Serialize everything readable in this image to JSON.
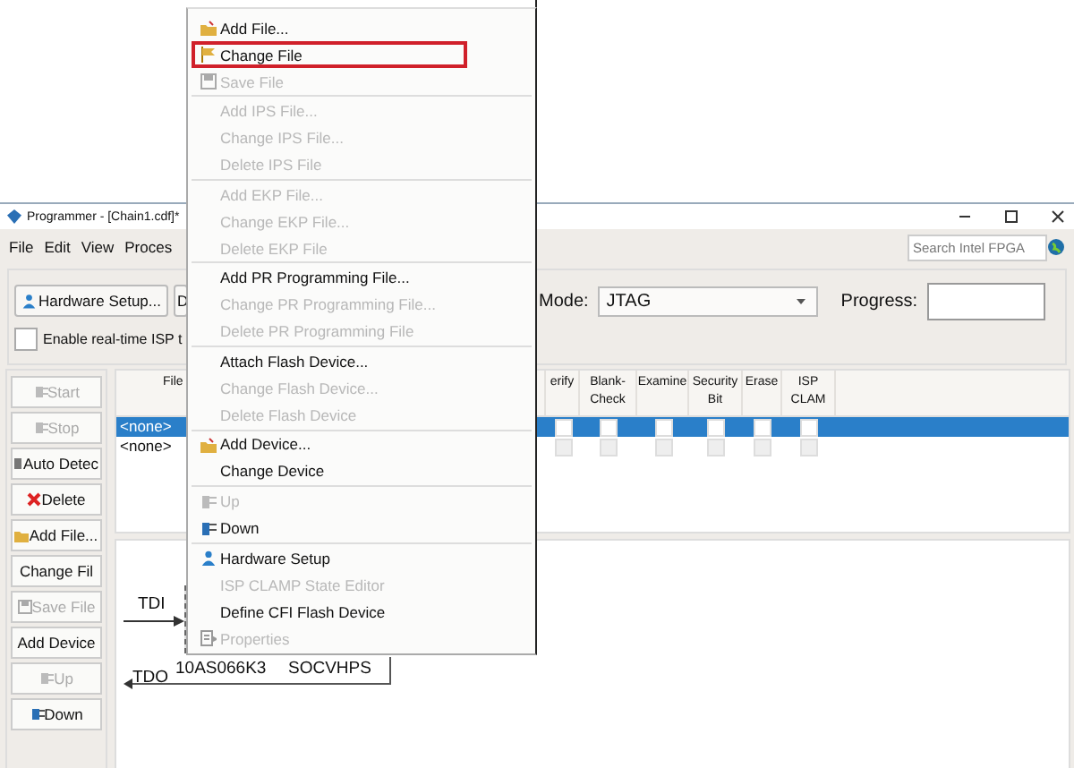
{
  "window": {
    "title": "Programmer - [Chain1.cdf]*"
  },
  "menu_bar": [
    "File",
    "Edit",
    "View",
    "Proces"
  ],
  "search": {
    "placeholder": "Search Intel FPGA"
  },
  "toolbar": {
    "hardware_button": "Hardware Setup...",
    "cut_button": "D",
    "mode_label": "Mode:",
    "mode_value": "JTAG",
    "progress_label": "Progress:",
    "realtime_isp": {
      "label": "Enable real-time ISP t",
      "checked": false
    }
  },
  "side_buttons": [
    {
      "label": "Start",
      "disabled": true
    },
    {
      "label": "Stop",
      "disabled": true
    },
    {
      "label": "Auto Detec",
      "disabled": false
    },
    {
      "label": "Delete",
      "disabled": false
    },
    {
      "label": "Add File...",
      "disabled": false
    },
    {
      "label": "Change Fil",
      "disabled": false
    },
    {
      "label": "Save File",
      "disabled": true
    },
    {
      "label": "Add Device",
      "disabled": false
    },
    {
      "label": "Up",
      "disabled": true
    },
    {
      "label": "Down",
      "disabled": false
    }
  ],
  "table": {
    "columns": [
      "File",
      "erify",
      "Blank-Check",
      "Examine",
      "Security Bit",
      "Erase",
      "ISP CLAM"
    ],
    "rows": [
      {
        "file": "<none>",
        "selected": true,
        "checks": [
          false,
          false,
          false,
          false,
          false,
          false
        ]
      },
      {
        "file": "<none>",
        "selected": false,
        "checks": [
          false,
          false,
          false,
          false,
          false,
          false
        ]
      }
    ]
  },
  "chain": {
    "tdi": "TDI",
    "tdo": "TDO",
    "devices": [
      "10AS066K3",
      "SOCVHPS"
    ]
  },
  "context_menu": [
    {
      "kind": "item",
      "label": "Add File...",
      "disabled": false,
      "selected": false
    },
    {
      "kind": "item",
      "label": "Change File",
      "disabled": false,
      "selected": true
    },
    {
      "kind": "item",
      "label": "Save File",
      "disabled": true,
      "selected": false
    },
    {
      "kind": "separator"
    },
    {
      "kind": "item",
      "label": "Add IPS File...",
      "disabled": true,
      "selected": false
    },
    {
      "kind": "item",
      "label": "Change IPS File...",
      "disabled": true,
      "selected": false
    },
    {
      "kind": "item",
      "label": "Delete IPS File",
      "disabled": true,
      "selected": false
    },
    {
      "kind": "separator"
    },
    {
      "kind": "item",
      "label": "Add EKP File...",
      "disabled": true,
      "selected": false
    },
    {
      "kind": "item",
      "label": "Change EKP File...",
      "disabled": true,
      "selected": false
    },
    {
      "kind": "item",
      "label": "Delete EKP File",
      "disabled": true,
      "selected": false
    },
    {
      "kind": "separator"
    },
    {
      "kind": "item",
      "label": "Add PR Programming File...",
      "disabled": false,
      "selected": false
    },
    {
      "kind": "item",
      "label": "Change PR Programming File...",
      "disabled": true,
      "selected": false
    },
    {
      "kind": "item",
      "label": "Delete PR Programming File",
      "disabled": true,
      "selected": false
    },
    {
      "kind": "separator"
    },
    {
      "kind": "item",
      "label": "Attach Flash Device...",
      "disabled": false,
      "selected": false
    },
    {
      "kind": "item",
      "label": "Change Flash Device...",
      "disabled": true,
      "selected": false
    },
    {
      "kind": "item",
      "label": "Delete Flash Device",
      "disabled": true,
      "selected": false
    },
    {
      "kind": "separator"
    },
    {
      "kind": "item",
      "label": "Add Device...",
      "disabled": false,
      "selected": false
    },
    {
      "kind": "item",
      "label": "Change Device",
      "disabled": false,
      "selected": false
    },
    {
      "kind": "separator"
    },
    {
      "kind": "item",
      "label": "Up",
      "disabled": true,
      "selected": false
    },
    {
      "kind": "item",
      "label": "Down",
      "disabled": false,
      "selected": false
    },
    {
      "kind": "separator"
    },
    {
      "kind": "item",
      "label": "Hardware Setup",
      "disabled": false,
      "selected": false
    },
    {
      "kind": "item",
      "label": "ISP CLAMP State Editor",
      "disabled": true,
      "selected": false
    },
    {
      "kind": "item",
      "label": "Define CFI Flash Device",
      "disabled": false,
      "selected": false
    },
    {
      "kind": "item",
      "label": "Properties",
      "disabled": true,
      "selected": false
    }
  ]
}
